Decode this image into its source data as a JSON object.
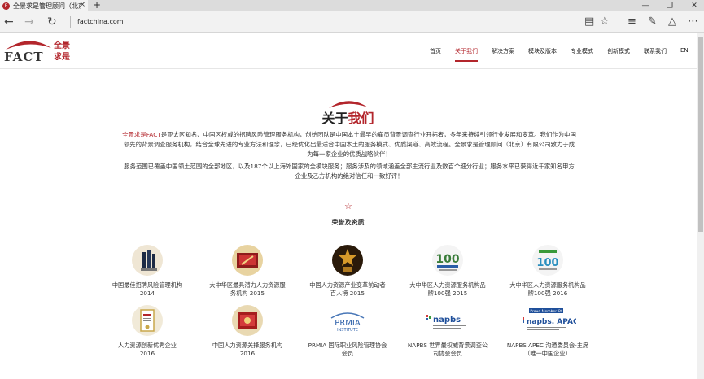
{
  "browser": {
    "tab_title": "全景求是管理顾问（北京",
    "tab_close": "×",
    "new_tab": "+",
    "url": "factchina.com"
  },
  "site": {
    "logo_text": "FACT",
    "logo_cn_line1": "全景",
    "logo_cn_line2": "求是",
    "menu": [
      "首页",
      "关于我们",
      "解决方案",
      "模块及版本",
      "专业模式",
      "创新模式",
      "联系我们",
      "EN"
    ]
  },
  "about": {
    "title_part1": "关于",
    "title_part2": "我们",
    "brand": "全景求是FACT",
    "p1_rest": "是亚太区知名、中国区权威的招聘风险管理服务机构，创始团队是中国本土最早的雇员背景调查行业开拓者，多年来持续引领行业发展和变革。我们作为中国领先的背景调查服务机构，结合全球先进的专业方法和理念，已经优化出最适合中国本土的服务模式、优质渠道、高效流程。全景求是管理顾问（北京）有限公司致力于成为每一家企业的优质战略伙伴！",
    "p2": "服务范围已覆盖中国领土范围的全部地区，以及187个以上海外国家的全模块服务；服务涉及的领域涵盖全部主流行业及数百个细分行业；服务水平已获得近千家知名甲方企业及乙方机构的绝对信任和一致好评！"
  },
  "honors": {
    "star": "☆",
    "title": "荣誉及资质",
    "awards": [
      {
        "line1": "中国最佳招聘风险管理机构",
        "line2": "2014"
      },
      {
        "line1": "大中华区最具潜力人力资源服",
        "line2": "务机构 2015"
      },
      {
        "line1": "中国人力资源产业变革前动者",
        "line2": "百人榜 2015"
      },
      {
        "line1": "大中华区人力资源服务机构品",
        "line2": "牌100强 2015"
      },
      {
        "line1": "大中华区人力资源服务机构品",
        "line2": "牌100强 2016"
      },
      {
        "line1": "人力资源创新优秀企业",
        "line2": "2016"
      },
      {
        "line1": "中国人力资源关择服务机构",
        "line2": "2016"
      },
      {
        "line1": "PRMIA 国际职业风险管理协会",
        "line2": "会员"
      },
      {
        "line1": "NAPBS 世界最权威背景调查公",
        "line2": "司协会会员"
      },
      {
        "line1": "NAPBS APEC 沟通委员会-主席",
        "line2": "（唯一中国企业）"
      }
    ],
    "badge_text": {
      "prmia": "PRMIA",
      "prmia_sub": "INSTITUTE",
      "napbs": "napbs",
      "napbs_apac": "napbs. APAC",
      "proud_member": "Proud Member Of",
      "hundred": "100"
    }
  },
  "colors": {
    "brand_red": "#b3262c"
  }
}
